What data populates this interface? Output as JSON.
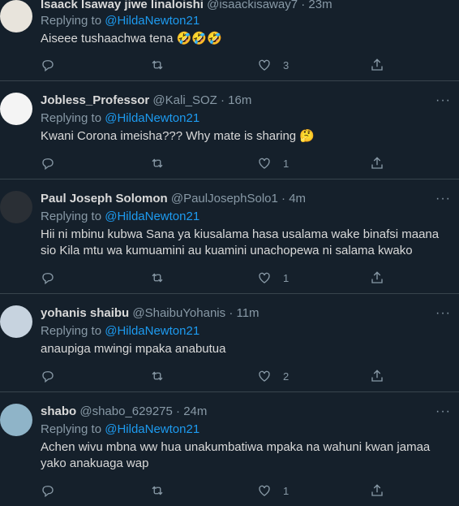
{
  "tweets": [
    {
      "name": "Isaack Isaway jiwe linaloishi",
      "handle": "@isaackisaway7",
      "time": "23m",
      "replying_label": "Replying to",
      "replying_to": "@HildaNewton21",
      "text": "Aiseee tushaachwa tena 🤣🤣🤣",
      "like_count": "3"
    },
    {
      "name": "Jobless_Professor",
      "handle": "@Kali_SOZ",
      "time": "16m",
      "replying_label": "Replying to",
      "replying_to": "@HildaNewton21",
      "text": "Kwani Corona imeisha??? Why mate is sharing 🤔",
      "like_count": "1"
    },
    {
      "name": "Paul Joseph Solomon",
      "handle": "@PaulJosephSolo1",
      "time": "4m",
      "replying_label": "Replying to",
      "replying_to": "@HildaNewton21",
      "text": "Hii ni mbinu kubwa Sana ya kiusalama hasa usalama wake binafsi maana sio Kila mtu wa kumuamini au kuamini unachopewa ni salama kwako",
      "like_count": "1"
    },
    {
      "name": "yohanis shaibu",
      "handle": "@ShaibuYohanis",
      "time": "11m",
      "replying_label": "Replying to",
      "replying_to": "@HildaNewton21",
      "text": "anaupiga mwingi mpaka anabutua",
      "like_count": "2"
    },
    {
      "name": "shabo",
      "handle": "@shabo_629275",
      "time": "24m",
      "replying_label": "Replying to",
      "replying_to": "@HildaNewton21",
      "text": "Achen wivu mbna ww hua unakumbatiwa mpaka na wahuni kwan jamaa yako anakuaga wap",
      "like_count": "1"
    }
  ],
  "more_label": "···",
  "separator": "·",
  "icons": [
    "reply-icon",
    "retweet-icon",
    "like-icon",
    "share-icon",
    "more-icon"
  ],
  "colors": {
    "background": "#15202b",
    "mention": "#1d9bf0",
    "muted": "#8899a6",
    "border": "#38444d"
  }
}
